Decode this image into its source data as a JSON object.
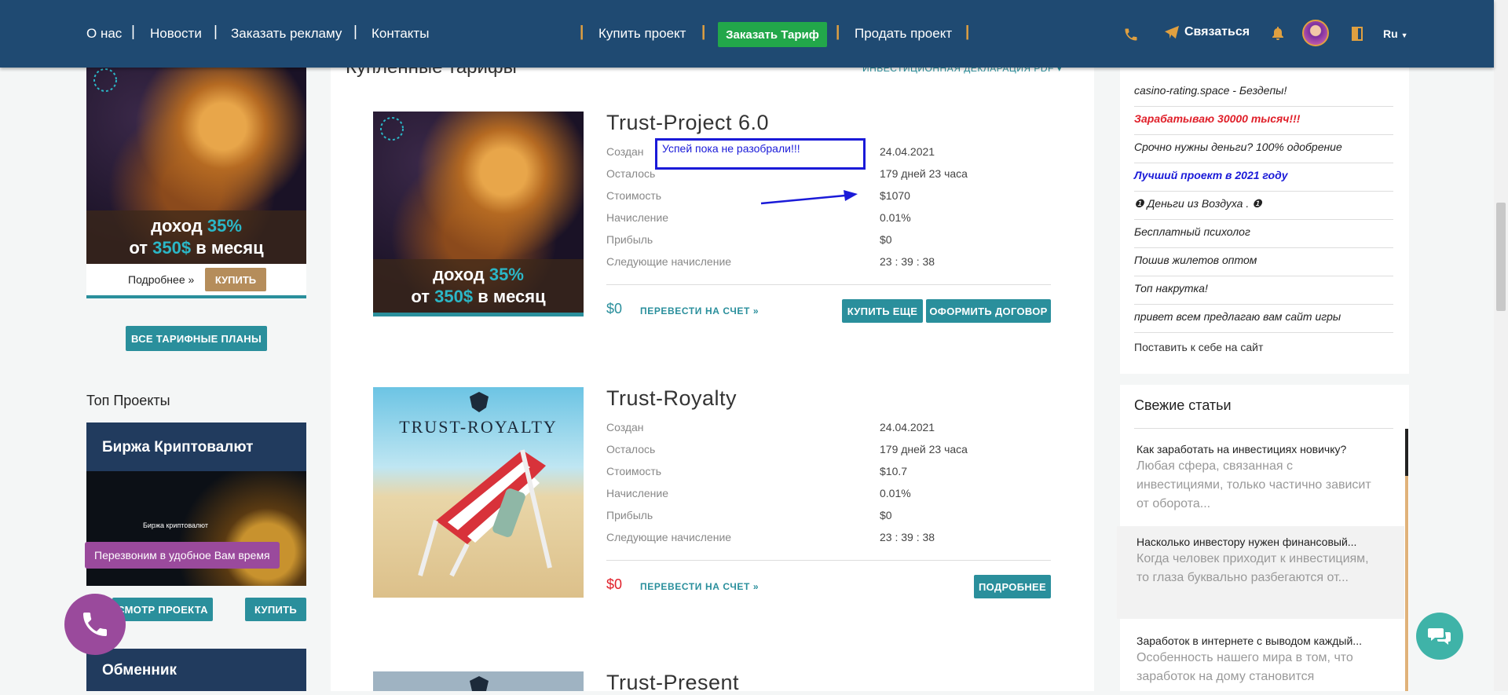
{
  "header": {
    "nav": [
      "О нас",
      "Новости",
      "Заказать рекламу",
      "Контакты"
    ],
    "buy_project": "Купить проект",
    "order_tariff": "Заказать Тариф",
    "sell_project": "Продать проект",
    "contact": "Связаться",
    "lang": "Ru"
  },
  "left": {
    "promo": {
      "line1_prefix": "доход ",
      "line1_value": "35%",
      "line2_prefix": "от ",
      "line2_value": "350$",
      "line2_suffix": " в месяц"
    },
    "more_link": "Подробнее »",
    "buy_button": "КУПИТЬ",
    "all_plans_button": "ВСЕ ТАРИФНЫЕ ПЛАНЫ",
    "top_projects_title": "Топ Проекты",
    "card1_title": "Биржа Криптовалют",
    "card1_inner_title": "Биржа криптовалют",
    "callback_tooltip": "Перезвоним в удобное Вам время",
    "view_project": "СМОТР ПРОЕКТА",
    "card1_buy": "КУПИТЬ",
    "card2_title": "Обменник"
  },
  "main": {
    "section_title": "Купленные тарифы",
    "declaration_link": "ИНВЕСТИЦИОННАЯ ДЕКЛАРАЦИЯ PDF",
    "labels": [
      "Создан",
      "Осталось",
      "Стоимость",
      "Начисление",
      "Прибыль",
      "Следующие начисление"
    ],
    "annotation": "Успей пока не разобрали!!!",
    "projects": [
      {
        "title": "Trust-Project 6.0",
        "values": [
          "24.04.2021",
          "179 дней 23 часа",
          "$1070",
          "0.01%",
          "$0",
          "23 : 39 : 38"
        ],
        "balance": "$0",
        "transfer": "ПЕРЕВЕСТИ НА СЧЕТ »",
        "buy_more": "КУПИТЬ ЕЩЕ",
        "contract": "ОФОРМИТЬ ДОГОВОР"
      },
      {
        "title": "Trust-Royalty",
        "image_text": "TRUST-ROYALTY",
        "values": [
          "24.04.2021",
          "179 дней 23 часа",
          "$10.7",
          "0.01%",
          "$0",
          "23 : 39 : 38"
        ],
        "balance": "$0",
        "transfer": "ПЕРЕВЕСТИ НА СЧЕТ »",
        "details": "ПОДРОБНЕЕ"
      },
      {
        "title": "Trust-Present"
      }
    ]
  },
  "right": {
    "ads": [
      "casino-rating.space - Бездепы!",
      "Зарабатываю 30000 тысяч!!!",
      "Срочно нужны деньги? 100% одобрение",
      "Лучший проект в 2021 году",
      "❶ Деньги из Воздуха . ❶",
      "Бесплатный психолог",
      "Пошив жилетов оптом",
      "Топ накрутка!",
      "привет всем предлагаю вам сайт игры"
    ],
    "place_on_site": "Поставить к себе на сайт",
    "fresh_title": "Свежие статьи",
    "articles": [
      {
        "title": "Как заработать на инвестициях новичку?",
        "excerpt": "Любая сфера, связанная с инвестициями, только частично зависит от оборота..."
      },
      {
        "title": "Насколько инвестору нужен финансовый...",
        "excerpt": "Когда человек приходит к инвестициям, то глаза буквально разбегаются от..."
      },
      {
        "title": "Заработок в интернете с выводом каждый...",
        "excerpt": "Особенность нашего мира в том, что заработок на дому становится"
      }
    ]
  },
  "colors": {
    "header": "#1f4a72",
    "accent": "#2a8f9c",
    "green": "#22a74a",
    "red": "#e0202a"
  }
}
